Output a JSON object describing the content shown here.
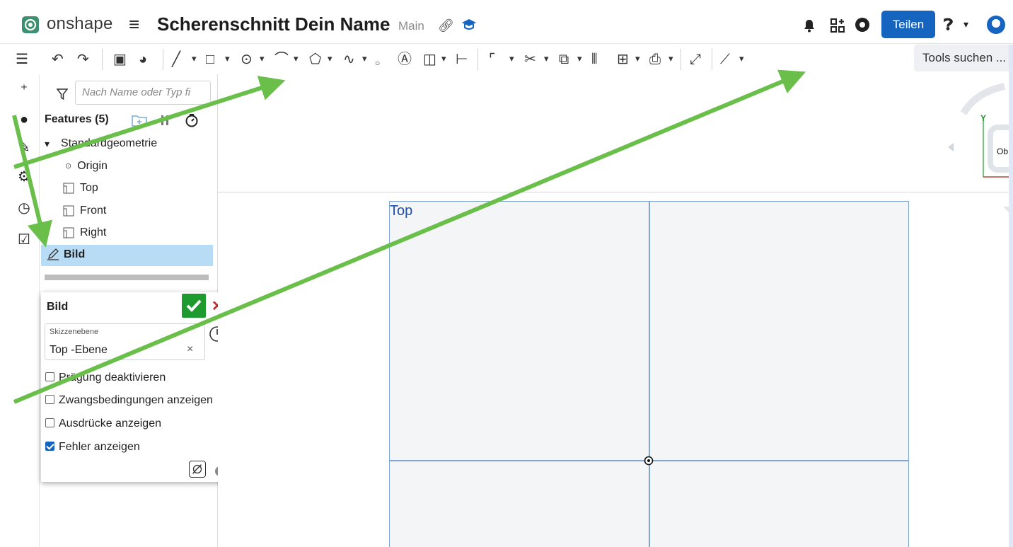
{
  "app": {
    "brand": "onshape",
    "document_title": "Scherenschnitt Dein Name",
    "branch": "Main",
    "share_label": "Teilen"
  },
  "toolbar": {
    "tools_search_placeholder": "Tools suchen ..."
  },
  "feature_tree": {
    "filter_placeholder": "Nach Name oder Typ fi",
    "features_header": "Features (5)",
    "group_label": "Standardgeometrie",
    "items": [
      {
        "label": "Origin",
        "icon": "origin-icon"
      },
      {
        "label": "Top",
        "icon": "plane-icon"
      },
      {
        "label": "Front",
        "icon": "plane-icon"
      },
      {
        "label": "Right",
        "icon": "plane-icon"
      }
    ],
    "selected_item": "Bild"
  },
  "sketch_dialog": {
    "title": "Bild",
    "plane_caption": "Skizzenebene",
    "plane_value": "Top -Ebene",
    "plane_clear": "×",
    "options": [
      {
        "label": "Prägung deaktivieren",
        "checked": false
      },
      {
        "label": "Zwangsbedingungen anzeigen",
        "checked": false
      },
      {
        "label": "Ausdrücke anzeigen",
        "checked": false
      },
      {
        "label": "Fehler anzeigen",
        "checked": true
      }
    ]
  },
  "graphics": {
    "plane_label": "Top"
  },
  "viewcube": {
    "axis_label": "Y",
    "face_label": "Ob"
  },
  "colors": {
    "accent": "#1565c0",
    "confirm": "#1e9a2e",
    "cancel": "#c62828",
    "selection": "#b8dcf5",
    "annotation_arrow": "#6abf4b",
    "sketch_plane_edge": "#7fa6d4"
  }
}
